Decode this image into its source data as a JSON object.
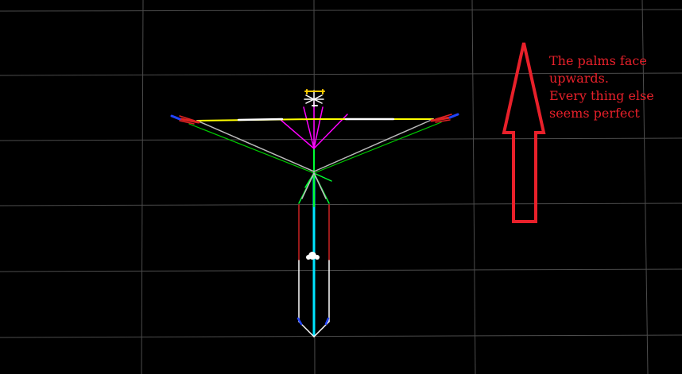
{
  "viewport": {
    "background_color": "#000000",
    "grid_color": "#5a5a5a"
  },
  "skeleton": {
    "colors": {
      "spine": "#00e5ff",
      "pelvis": "#00ff33",
      "neck": "#ff00ff",
      "clavicle_arm": "#ffff00",
      "upper_arm": "#ffffff",
      "arm_to_chest": "#bbbbbb",
      "arm_green": "#00cc00",
      "hand_red": "#dd2222",
      "hand_blue": "#2244ff",
      "leg_upper": "#cc2222",
      "leg_lower": "#ffffff",
      "head": "#ffffff",
      "head_accent": "#ffcc00",
      "foot": "#2244ff"
    }
  },
  "annotation": {
    "color": "#e8202a",
    "lines": [
      "The palms face",
      "upwards.",
      "Every thing else",
      "seems perfect"
    ]
  }
}
